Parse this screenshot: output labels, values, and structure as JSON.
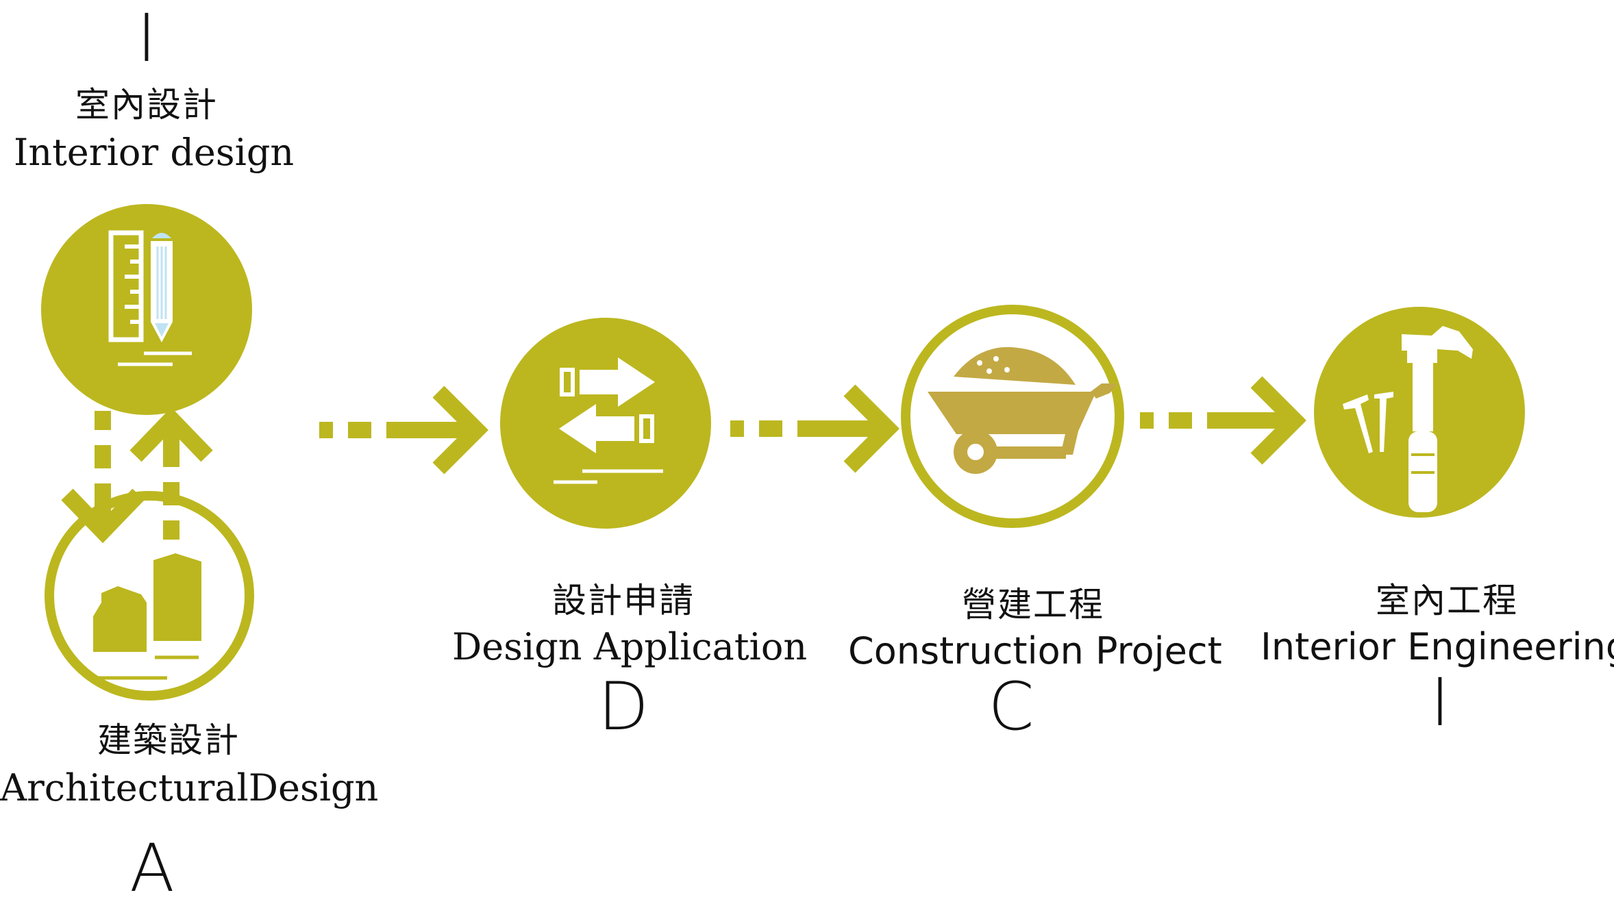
{
  "colors": {
    "accent": "#bcb71f",
    "accent_dark": "#c3a944",
    "ink": "#111111",
    "light_blue": "#bfe3f2"
  },
  "stages": {
    "interior_design": {
      "letter": "I",
      "zh": "室內設計",
      "en": "Interior design",
      "icon": "ruler-pencil-icon"
    },
    "architectural_design": {
      "zh": "建築設計",
      "en": "ArchitecturalDesign",
      "letter": "A",
      "icon": "buildings-icon"
    },
    "design_application": {
      "zh": "設計申請",
      "en": "Design Application",
      "letter": "D",
      "icon": "exchange-arrows-icon"
    },
    "construction_project": {
      "zh": "營建工程",
      "en": "Construction Project",
      "letter": "C",
      "icon": "wheelbarrow-icon"
    },
    "interior_engineering": {
      "zh": "室內工程",
      "en": "Interior Engineering",
      "letter": "I",
      "icon": "hammer-nails-icon"
    }
  }
}
